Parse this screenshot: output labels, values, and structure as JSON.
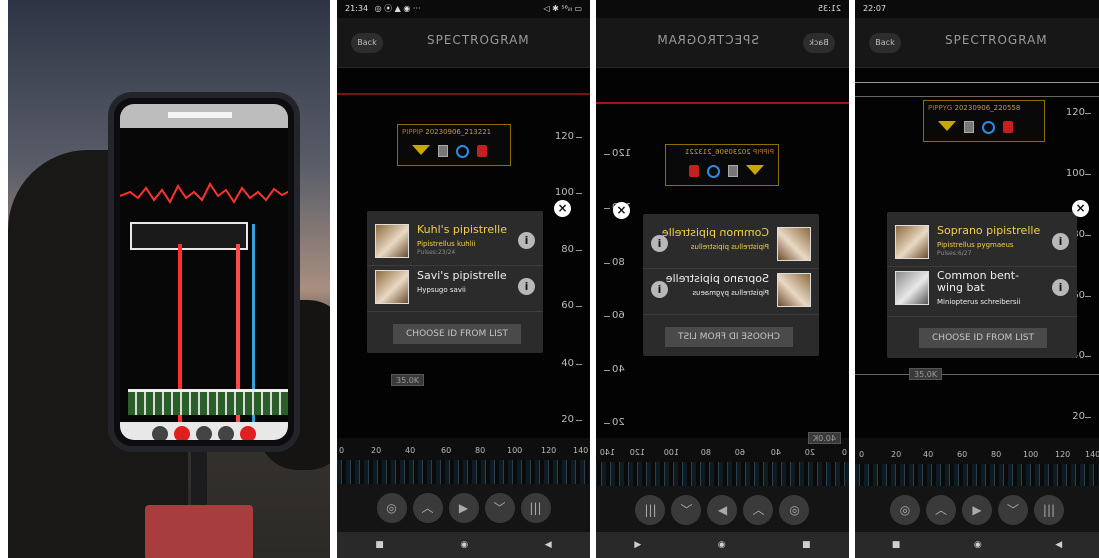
{
  "panels": {
    "a": {
      "status_time": "21:34",
      "status_icons_left": "◎ ⦿ ▲ ◉ ···",
      "status_icons_right": "◁ ✱ ⁵⁶ᵢₗₗ ▭",
      "back_label": "Back",
      "title": "SPECTROGRAM",
      "y_labels": [
        "120",
        "100",
        "80",
        "60",
        "40",
        "20"
      ],
      "record_species": "PIPPIP",
      "record_timestamp": "20230906_213221",
      "marker_label": "35.0K",
      "candidates": [
        {
          "name": "Kuhl's pipistrelle",
          "scientific": "Pipistrellus kuhlii",
          "pulses": "Pulses:23/24",
          "highlight": true
        },
        {
          "name": "Savi's pipistrelle",
          "scientific": "Hypsugo savii",
          "pulses": "",
          "highlight": false
        }
      ],
      "choose_label": "CHOOSE ID FROM LIST",
      "x_labels": [
        "0",
        "20",
        "40",
        "60",
        "80",
        "100",
        "120",
        "140"
      ]
    },
    "b": {
      "status_time": "21:35",
      "back_label": "Back",
      "title": "SPECTROGRAM",
      "y_labels": [
        "120",
        "100",
        "80",
        "60",
        "40",
        "20"
      ],
      "record_species": "PIPPIP",
      "record_timestamp": "20230906_213221",
      "marker_label": "40.0K",
      "candidates": [
        {
          "name": "Common pipistrelle",
          "scientific": "Pipistrellus pipistrellus",
          "pulses": "",
          "highlight": true
        },
        {
          "name": "Soprano pipistrelle",
          "scientific": "Pipistrellus pygmaeus",
          "pulses": "",
          "highlight": false
        }
      ],
      "choose_label": "CHOOSE ID FROM LIST",
      "x_labels": [
        "0",
        "20",
        "40",
        "60",
        "80",
        "100",
        "120",
        "140"
      ]
    },
    "c": {
      "status_time": "22:07",
      "back_label": "Back",
      "title": "SPECTROGRAM",
      "y_labels": [
        "120",
        "100",
        "80",
        "60",
        "40",
        "20"
      ],
      "record_species": "PIPPYG",
      "record_timestamp": "20230906_220558",
      "marker_label": "35.0K",
      "candidates": [
        {
          "name": "Soprano pipistrelle",
          "scientific": "Pipistrellus pygmaeus",
          "pulses": "Pulses:6/27",
          "highlight": true
        },
        {
          "name": "Common bent-wing bat",
          "scientific": "Miniopterus schreibersii",
          "pulses": "",
          "highlight": false
        }
      ],
      "choose_label": "CHOOSE ID FROM LIST",
      "x_labels": [
        "0",
        "20",
        "40",
        "60",
        "80",
        "100",
        "120",
        "140"
      ]
    }
  },
  "colors": {
    "highlight_text": "#f3d04a",
    "record_border": "#8d6c00",
    "trash_red": "#c61f1f",
    "circle_blue": "#2f8ae0"
  }
}
